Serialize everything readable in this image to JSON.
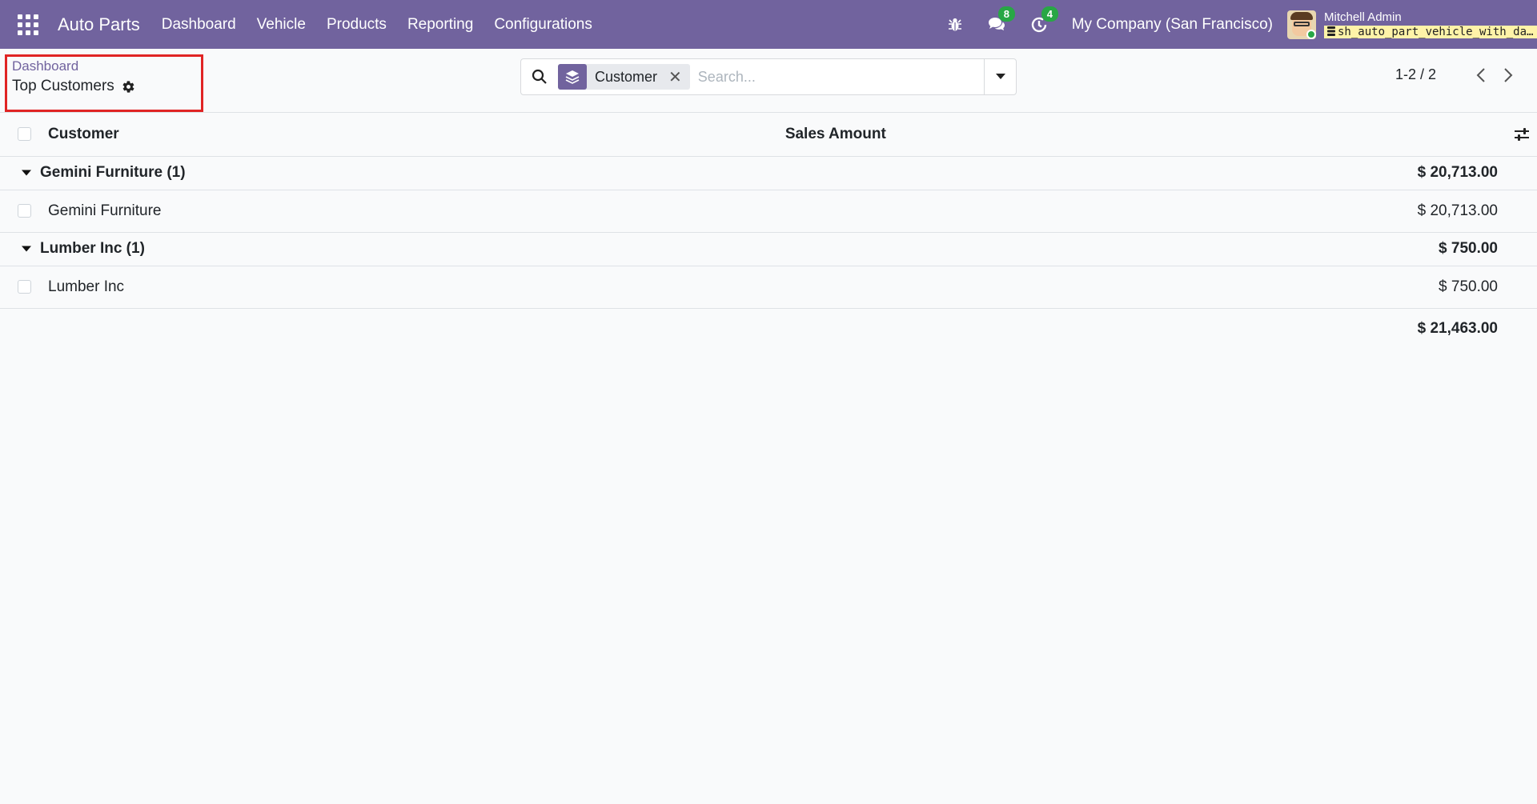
{
  "navbar": {
    "app_name": "Auto Parts",
    "menu": [
      "Dashboard",
      "Vehicle",
      "Products",
      "Reporting",
      "Configurations"
    ],
    "messages_count": "8",
    "activities_count": "4",
    "company": "My Company (San Francisco)",
    "user_name": "Mitchell Admin",
    "database": "sh_auto_part_vehicle_with_dashboard",
    "accent_color": "#71639e"
  },
  "breadcrumb": {
    "parent": "Dashboard",
    "current": "Top Customers"
  },
  "search": {
    "facet_label": "Customer",
    "placeholder": "Search..."
  },
  "pager": {
    "value": "1-2 / 2"
  },
  "table": {
    "columns": [
      "Customer",
      "Sales Amount"
    ],
    "groups": [
      {
        "name": "Gemini Furniture (1)",
        "total": "$ 20,713.00",
        "records": [
          {
            "customer": "Gemini Furniture",
            "amount": "$ 20,713.00"
          }
        ]
      },
      {
        "name": "Lumber Inc (1)",
        "total": "$ 750.00",
        "records": [
          {
            "customer": "Lumber Inc",
            "amount": "$ 750.00"
          }
        ]
      }
    ],
    "grand_total": "$ 21,463.00"
  }
}
